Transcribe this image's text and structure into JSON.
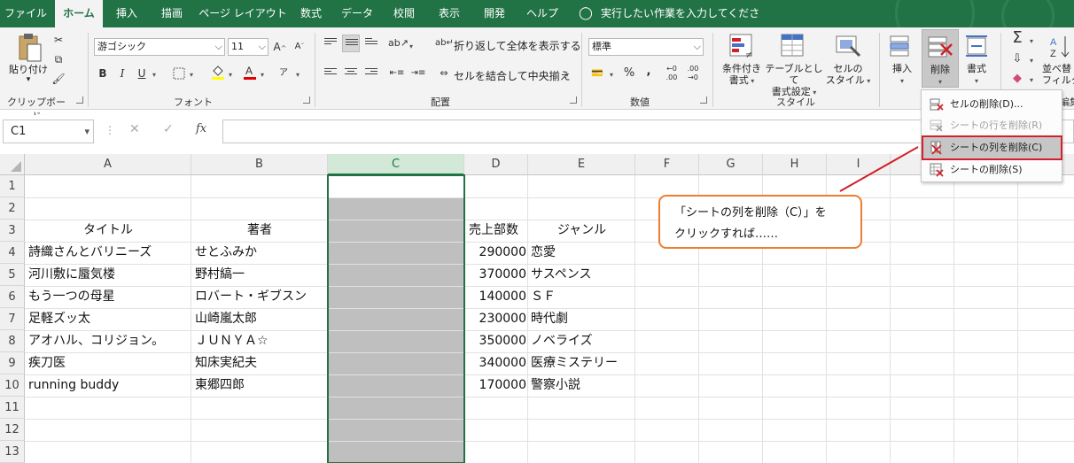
{
  "tabs": [
    {
      "label": "ファイル",
      "active": false
    },
    {
      "label": "ホーム",
      "active": true
    },
    {
      "label": "挿入",
      "active": false
    },
    {
      "label": "描画",
      "active": false
    },
    {
      "label": "ページ レイアウト",
      "active": false
    },
    {
      "label": "数式",
      "active": false
    },
    {
      "label": "データ",
      "active": false
    },
    {
      "label": "校閲",
      "active": false
    },
    {
      "label": "表示",
      "active": false
    },
    {
      "label": "開発",
      "active": false
    },
    {
      "label": "ヘルプ",
      "active": false
    }
  ],
  "tell_me": {
    "icon": "lightbulb-icon",
    "placeholder": "実行したい作業を入力してください"
  },
  "ribbon": {
    "clipboard": {
      "paste_label": "貼り付け",
      "group_label": "クリップボード"
    },
    "font": {
      "font_name": "游ゴシック",
      "font_size": "11",
      "bold": "B",
      "italic": "I",
      "underline": "U",
      "grow": "A",
      "shrink": "A",
      "group_label": "フォント"
    },
    "alignment": {
      "wrap_text": "折り返して全体を表示する",
      "merge_center": "セルを結合して中央揃え",
      "group_label": "配置"
    },
    "number": {
      "format": "標準",
      "percent": "%",
      "comma": ",",
      "group_label": "数値"
    },
    "styles": {
      "conditional_1": "条件付き",
      "conditional_2": "書式",
      "table_1": "テーブルとして",
      "table_2": "書式設定",
      "cell_1": "セルの",
      "cell_2": "スタイル",
      "group_label": "スタイル"
    },
    "cells": {
      "insert": "挿入",
      "delete": "削除",
      "format": "書式"
    },
    "editing": {
      "sort_1": "並べ替",
      "sort_2": "フィルタ",
      "group_label": "編集"
    }
  },
  "formula_bar": {
    "name_box": "C1",
    "fx": "fx",
    "cancel": "✕",
    "enter": "✓",
    "formula": ""
  },
  "columns": [
    "A",
    "B",
    "C",
    "D",
    "E",
    "F",
    "G",
    "H",
    "I"
  ],
  "selected_column": "C",
  "rows": [
    "1",
    "2",
    "3",
    "4",
    "5",
    "6",
    "7",
    "8",
    "9",
    "10",
    "11",
    "12",
    "13"
  ],
  "headers_row3": {
    "title": "タイトル",
    "author": "著者",
    "sales": "売上部数",
    "genre": "ジャンル"
  },
  "books": [
    {
      "title": "詩織さんとバリニーズ",
      "author": "せとふみか",
      "sales": "290000",
      "genre": "恋愛"
    },
    {
      "title": "河川敷に蜃気楼",
      "author": "野村縞一",
      "sales": "370000",
      "genre": "サスペンス"
    },
    {
      "title": "もう一つの母星",
      "author": "ロバート・ギブスン",
      "sales": "140000",
      "genre": "ＳＦ"
    },
    {
      "title": "足軽ズッ太",
      "author": "山崎嵐太郎",
      "sales": "230000",
      "genre": "時代劇"
    },
    {
      "title": "アオハル、コリジョン。",
      "author": "ＪＵＮＹＡ☆",
      "sales": "350000",
      "genre": "ノベライズ"
    },
    {
      "title": "疾刀医",
      "author": "知床実紀夫",
      "sales": "340000",
      "genre": "医療ミステリー"
    },
    {
      "title": "running buddy",
      "author": "東郷四郎",
      "sales": "170000",
      "genre": "警察小説"
    }
  ],
  "delete_menu": [
    {
      "label": "セルの削除(D)...",
      "disabled": false,
      "highlighted": false,
      "icon": "delete-cells-icon"
    },
    {
      "label": "シートの行を削除(R)",
      "disabled": true,
      "highlighted": false,
      "icon": "delete-rows-icon"
    },
    {
      "label": "シートの列を削除(C)",
      "disabled": false,
      "highlighted": true,
      "icon": "delete-columns-icon"
    },
    {
      "label": "シートの削除(S)",
      "disabled": false,
      "highlighted": false,
      "icon": "delete-sheet-icon"
    }
  ],
  "callout": {
    "line1": "「シートの列を削除（C）」を",
    "line2": "クリックすれば……"
  },
  "colors": {
    "excel_green": "#217346",
    "highlight_red": "#d3202a",
    "callout_orange": "#ed7d31",
    "selected_column_fill": "#bfbfbf"
  }
}
